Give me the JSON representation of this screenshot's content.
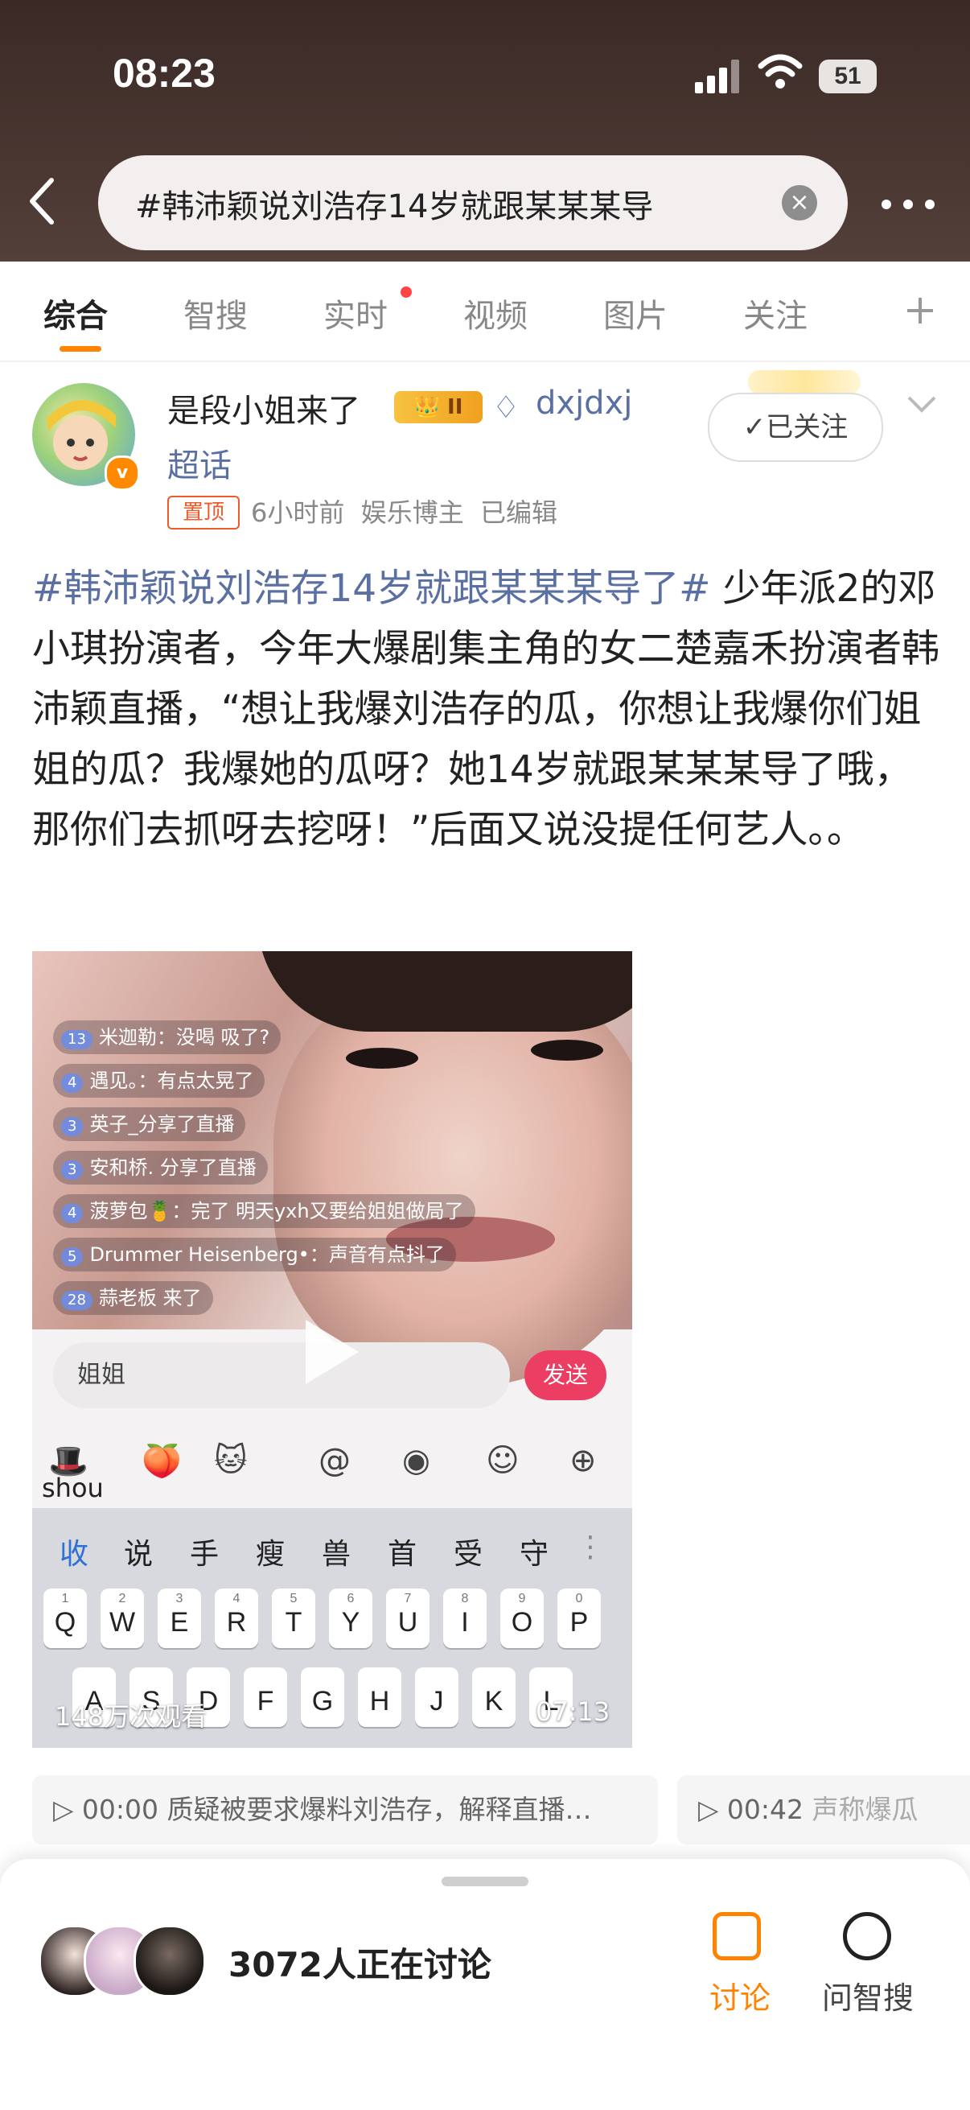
{
  "status_bar": {
    "time": "08:23",
    "battery": "51"
  },
  "search": {
    "query": "#韩沛颖说刘浩存14岁就跟某某某导"
  },
  "tabs": [
    {
      "label": "综合"
    },
    {
      "label": "智搜"
    },
    {
      "label": "实时"
    },
    {
      "label": "视频"
    },
    {
      "label": "图片"
    },
    {
      "label": "关注"
    }
  ],
  "post": {
    "author": "是段小姐来了",
    "level_badge": "II",
    "fan_tag": "dxjdxj",
    "chaohua": "超话",
    "follow_label": "已关注",
    "pinned": "置顶",
    "meta": "6小时前  娱乐博主  已编辑",
    "topic": "#韩沛颖说刘浩存14岁就跟某某某导了#",
    "text": " 少年派2的邓小琪扮演者，今年大爆剧集主角的女二楚嘉禾扮演者韩沛颖直播，“想让我爆刘浩存的瓜，你想让我爆你们姐姐的瓜？我爆她的瓜呀？她14岁就跟某某某导了哦，那你们去抓呀去挖呀！”后面又说没提任何艺人。。"
  },
  "video": {
    "comments": [
      {
        "lvl": "13",
        "text": "米迦勒：没喝 吸了?"
      },
      {
        "lvl": "4",
        "text": "遇见。：有点太晃了"
      },
      {
        "lvl": "3",
        "text": "英子_分享了直播"
      },
      {
        "lvl": "3",
        "text": "安和桥. 分享了直播"
      },
      {
        "lvl": "4",
        "text": "菠萝包🍍：完了 明天yxh又要给姐姐做局了"
      },
      {
        "lvl": "5",
        "text": "Drummer Heisenberg•：声音有点抖了"
      },
      {
        "lvl": "28",
        "text": "蒜老板 来了"
      }
    ],
    "input_text": "姐姐",
    "send_label": "发送",
    "emoji_label": "shou",
    "candidates": [
      "收",
      "说",
      "手",
      "瘦",
      "兽",
      "首",
      "受",
      "守"
    ],
    "keys": [
      {
        "num": "1",
        "ch": "Q"
      },
      {
        "num": "2",
        "ch": "W"
      },
      {
        "num": "3",
        "ch": "E"
      },
      {
        "num": "4",
        "ch": "R"
      },
      {
        "num": "5",
        "ch": "T"
      },
      {
        "num": "6",
        "ch": "Y"
      },
      {
        "num": "7",
        "ch": "U"
      },
      {
        "num": "8",
        "ch": "I"
      },
      {
        "num": "9",
        "ch": "O"
      },
      {
        "num": "0",
        "ch": "P"
      }
    ],
    "keys_row2": [
      "A",
      "S",
      "D",
      "F",
      "G",
      "H",
      "J",
      "K",
      "L"
    ],
    "views": "148万次观看",
    "duration": "07:13"
  },
  "chapters": [
    {
      "time": "00:00",
      "text": "质疑被要求爆料刘浩存，解释直播…"
    },
    {
      "time": "00:42",
      "text": "声称爆瓜"
    }
  ],
  "bottom": {
    "discussing": "3072人正在讨论",
    "discuss_label": "讨论",
    "ai_label": "问智搜"
  }
}
